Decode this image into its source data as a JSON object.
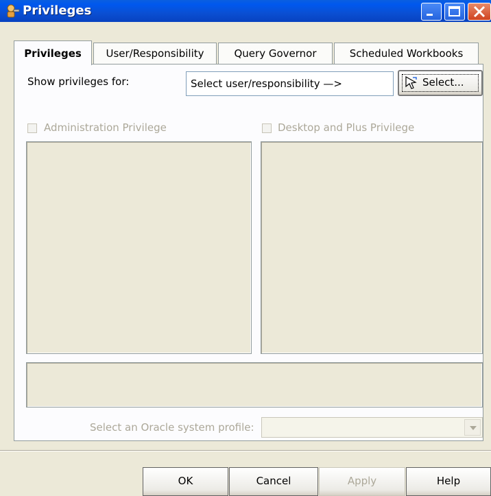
{
  "window": {
    "title": "Privileges",
    "title_icon": "key-user-icon",
    "controls": [
      "minimize-icon",
      "maximize-icon",
      "close-icon"
    ]
  },
  "tabs": [
    {
      "label": "Privileges",
      "active": true
    },
    {
      "label": "User/Responsibility",
      "active": false
    },
    {
      "label": "Query Governor",
      "active": false
    },
    {
      "label": "Scheduled Workbooks",
      "active": false
    }
  ],
  "show_privileges": {
    "label": "Show privileges for:",
    "value": "Select user/responsibility —>",
    "button_label": "Select...",
    "button_icon": "pointer-arrow-icon"
  },
  "admin_privilege": {
    "label": "Administration Privilege",
    "checked": false,
    "enabled": false
  },
  "desktop_privilege": {
    "label": "Desktop and Plus Privilege",
    "checked": false,
    "enabled": false
  },
  "profile": {
    "label": "Select an Oracle system profile:",
    "value": ""
  },
  "buttons": {
    "ok": "OK",
    "cancel": "Cancel",
    "apply": "Apply",
    "help": "Help"
  },
  "colors": {
    "titlebar": "#0a4fd3",
    "dialog_bg": "#ece9d8",
    "disabled_text": "#aca899"
  }
}
